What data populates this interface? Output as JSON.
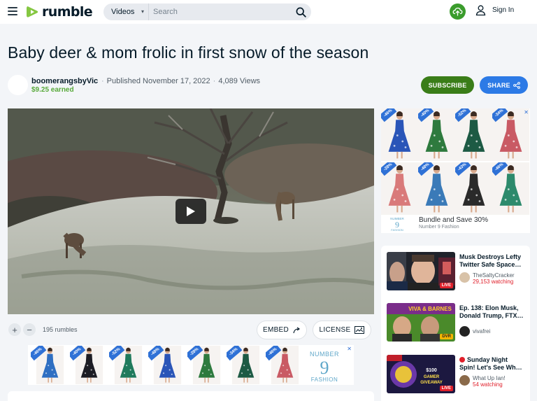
{
  "header": {
    "logo_text": "rumble",
    "search_category": "Videos",
    "search_placeholder": "Search",
    "signin_label": "Sign In",
    "brand_color": "#85c742",
    "upload_color": "#3a9c2c"
  },
  "video": {
    "title": "Baby deer & mom frolic in first snow of the season",
    "channel_name": "boomerangsbyVic",
    "earned": "$9.25 earned",
    "published": "Published November 17, 2022",
    "views": "4,089 Views",
    "subscribe_label": "SUBSCRIBE",
    "share_label": "SHARE",
    "rumbles": "195 rumbles",
    "embed_label": "EMBED",
    "license_label": "LICENSE"
  },
  "ads": {
    "bottom_badges": [
      "-46%",
      "-40%",
      "-52%",
      "-48%",
      "-28%",
      "-34%",
      "-46%"
    ],
    "bottom_brand": "NUMBER 9 FASHION",
    "right_badges": [
      "-46%",
      "-40%",
      "-52%",
      "-34%",
      "-28%",
      "-48%",
      "-43%",
      "-46%"
    ],
    "right_headline": "Bundle and Save 30%",
    "right_brand": "Number 9 Fashion",
    "close_label": "✕"
  },
  "recommendations": [
    {
      "title_line1": "Musk Destroys Lefty",
      "title_line2": "Twitter Safe Space…",
      "channel": "TheSaltyCracker",
      "watching": "29,153 watching",
      "badge": "LIVE",
      "thumb_caption": ""
    },
    {
      "title_line1": "Ep. 138: Elon Musk,",
      "title_line2": "Donald Trump, FTX…",
      "channel": "vivafrei",
      "watching": "",
      "badge": "DVR",
      "thumb_caption": "VIVA & BARNES"
    },
    {
      "title_line1": "Sunday Night",
      "title_line2": "Spin! Let's See Wh…",
      "channel": "What Up Ian!",
      "watching": "54 watching",
      "badge": "LIVE",
      "thumb_caption": "$100 GAMER GIVEAWAY"
    }
  ]
}
